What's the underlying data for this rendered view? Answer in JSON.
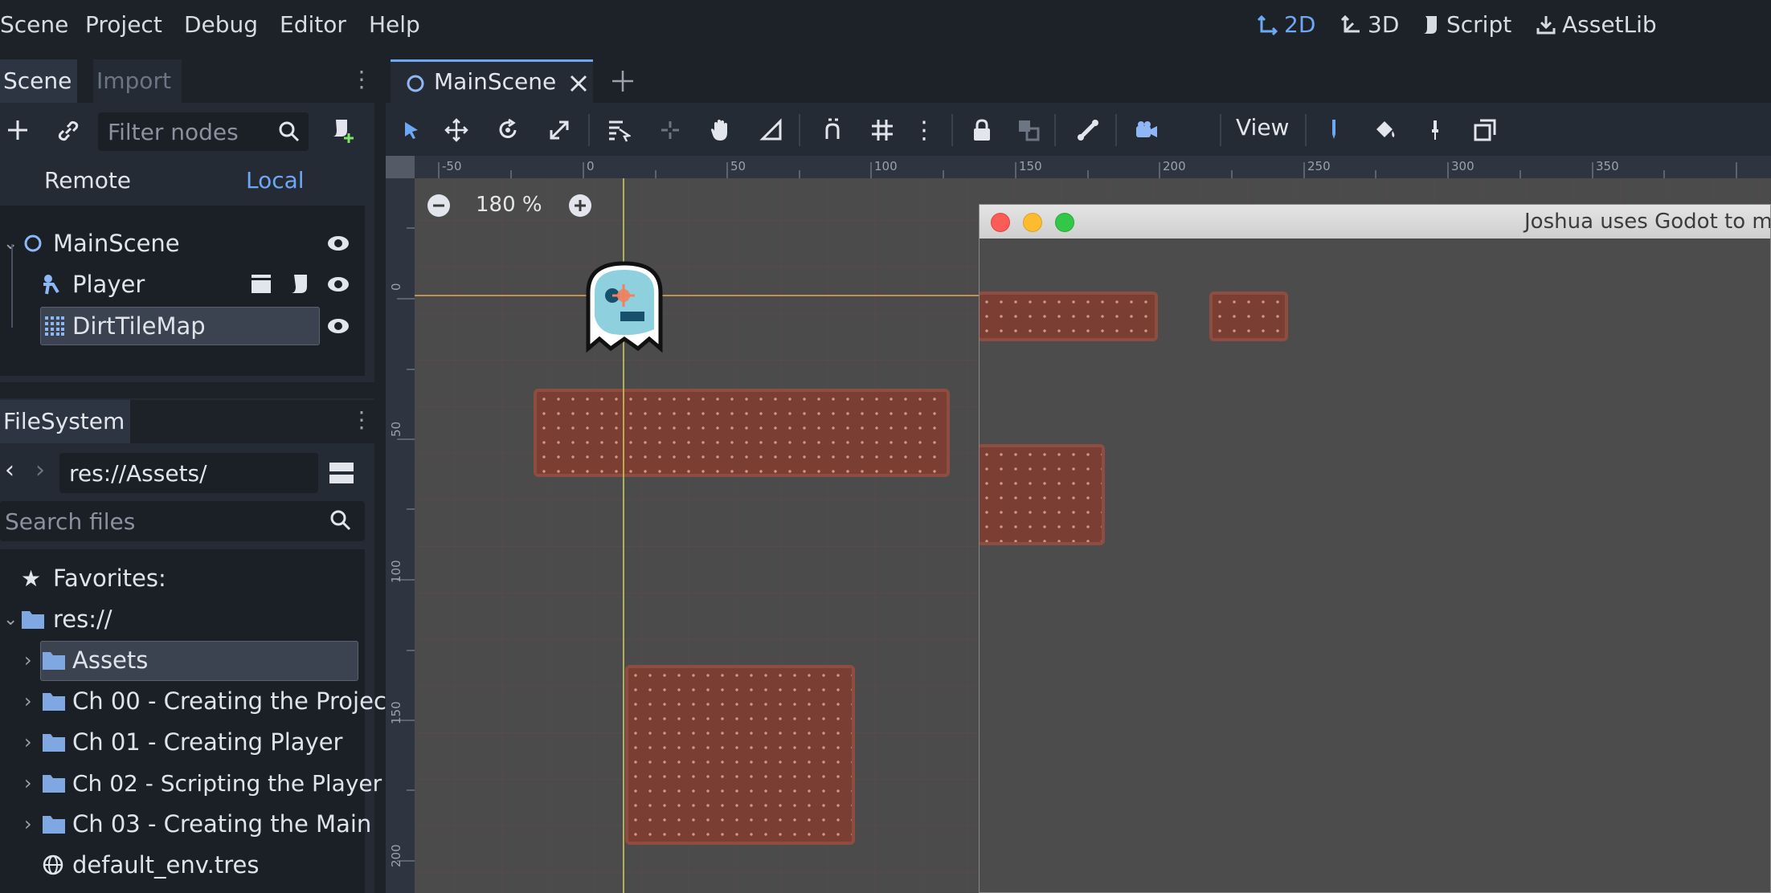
{
  "menubar": {
    "items": [
      "Scene",
      "Project",
      "Debug",
      "Editor",
      "Help"
    ],
    "workspaces": [
      {
        "label": "2D",
        "icon": "2d-icon",
        "active": true
      },
      {
        "label": "3D",
        "icon": "3d-icon",
        "active": false
      },
      {
        "label": "Script",
        "icon": "script-icon",
        "active": false
      },
      {
        "label": "AssetLib",
        "icon": "assetlib-icon",
        "active": false
      }
    ]
  },
  "scene_dock": {
    "tabs": [
      "Scene",
      "Import"
    ],
    "filter_placeholder": "Filter nodes",
    "remote_label": "Remote",
    "local_label": "Local",
    "nodes": [
      {
        "label": "MainScene",
        "icon": "node2d-icon"
      },
      {
        "label": "Player",
        "icon": "kinematic-body-icon"
      },
      {
        "label": "DirtTileMap",
        "icon": "tilemap-icon"
      }
    ]
  },
  "filesystem_dock": {
    "tab": "FileSystem",
    "path": "res://Assets/",
    "search_placeholder": "Search files",
    "favorites_label": "Favorites:",
    "root_label": "res://",
    "items": [
      "Assets",
      "Ch 00 - Creating the Projec",
      "Ch 01 - Creating Player",
      "Ch 02 - Scripting the Player",
      "Ch 03 - Creating the Main",
      "default_env.tres"
    ]
  },
  "editor": {
    "tab_label": "MainScene",
    "view_label": "View",
    "zoom_label": "180 %",
    "ruler_h": [
      "-50",
      "0",
      "50",
      "100",
      "150",
      "200",
      "250",
      "300",
      "350"
    ],
    "ruler_v": [
      "0",
      "50",
      "100",
      "150",
      "200"
    ]
  },
  "game_window": {
    "title": "Joshua uses Godot to ma"
  },
  "colors": {
    "accent": "#6ea8f5",
    "viewport_bg": "#4b4b4b",
    "tile": "#7a3e33",
    "guide_x": "#e0a050",
    "guide_y": "#c8c860"
  }
}
